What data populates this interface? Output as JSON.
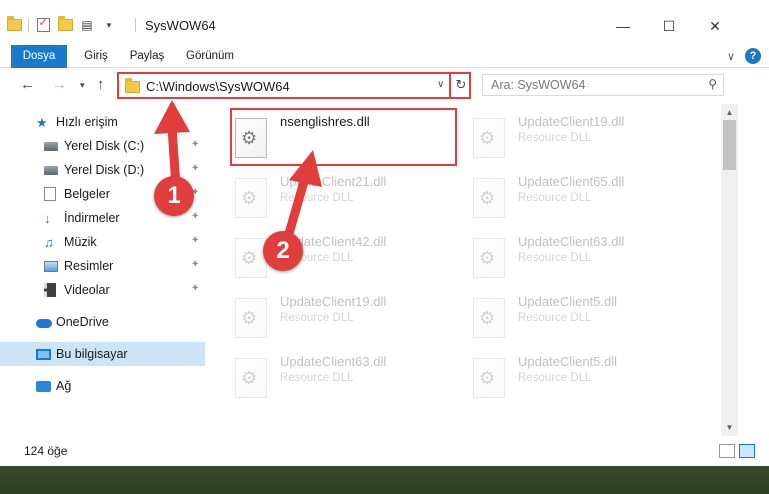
{
  "window": {
    "title": "SysWOW64"
  },
  "ribbon": {
    "tabs": [
      {
        "label": "Dosya"
      },
      {
        "label": "Giriş"
      },
      {
        "label": "Paylaş"
      },
      {
        "label": "Görünüm"
      }
    ]
  },
  "address": {
    "path": "C:\\Windows\\SysWOW64"
  },
  "search": {
    "placeholder": "Ara: SysWOW64"
  },
  "nav": {
    "items": [
      {
        "label": "Hızlı erişim"
      },
      {
        "label": "Yerel Disk (C:)"
      },
      {
        "label": "Yerel Disk (D:)"
      },
      {
        "label": "Belgeler"
      },
      {
        "label": "İndirmeler"
      },
      {
        "label": "Müzik"
      },
      {
        "label": "Resimler"
      },
      {
        "label": "Videolar"
      },
      {
        "label": "OneDrive"
      },
      {
        "label": "Bu bilgisayar"
      },
      {
        "label": "Ağ"
      }
    ]
  },
  "files": [
    {
      "name": "nsenglishres.dll",
      "desc": ""
    },
    {
      "name": "UpdateClient19.dll",
      "desc": "Resource DLL"
    },
    {
      "name": "UpdateClient21.dll",
      "desc": "Resource DLL"
    },
    {
      "name": "UpdateClient65.dll",
      "desc": "Resource DLL"
    },
    {
      "name": "UpdateClient42.dll",
      "desc": "Resource DLL"
    },
    {
      "name": "UpdateClient63.dll",
      "desc": "Resource DLL"
    },
    {
      "name": "UpdateClient19.dll",
      "desc": "Resource DLL"
    },
    {
      "name": "UpdateClient5.dll",
      "desc": "Resource DLL"
    },
    {
      "name": "UpdateClient63.dll",
      "desc": "Resource DLL"
    },
    {
      "name": "UpdateClient5.dll",
      "desc": "Resource DLL"
    }
  ],
  "status": {
    "count": "124 öğe"
  },
  "annotations": {
    "step1": "1",
    "step2": "2",
    "color": "#e03d3d"
  }
}
